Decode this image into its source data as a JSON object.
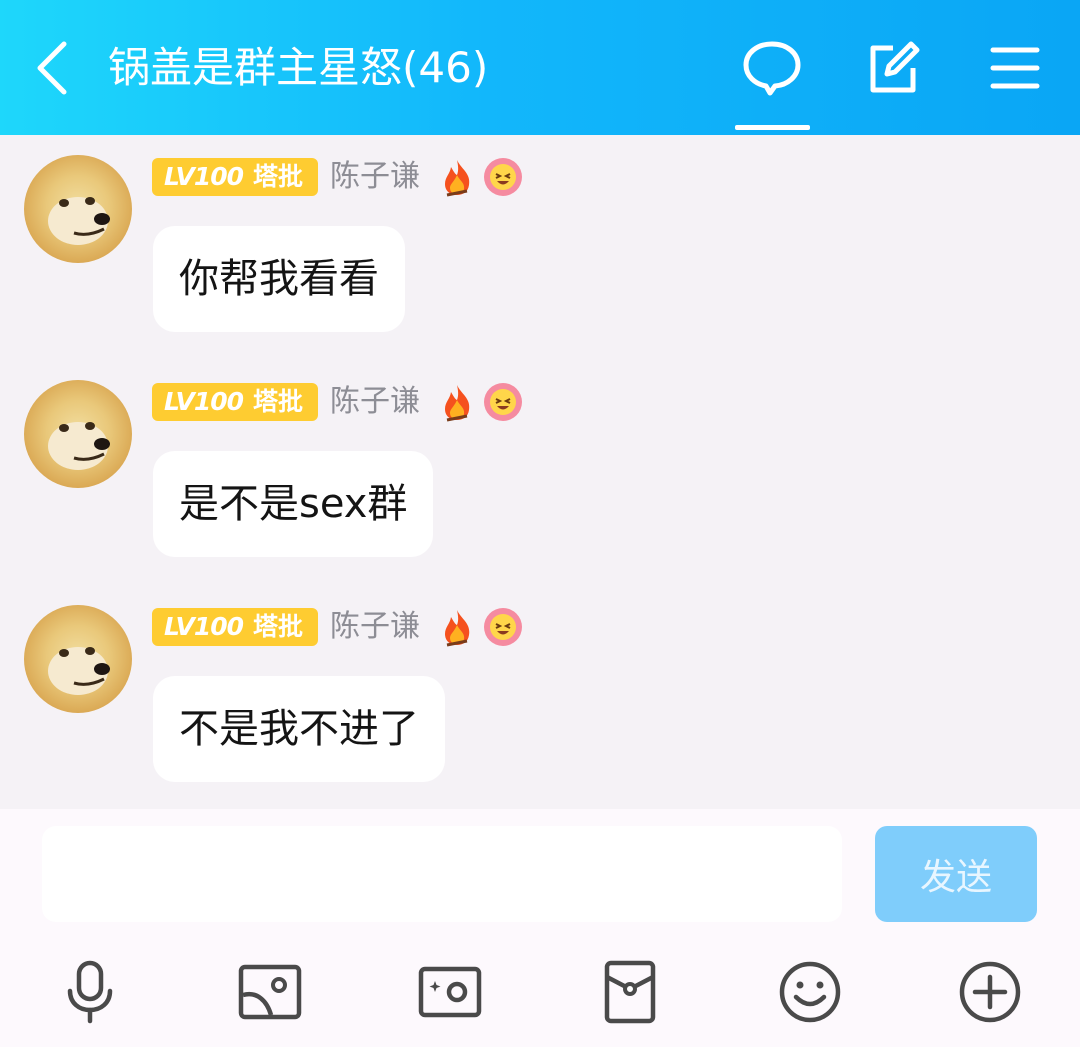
{
  "header": {
    "title": "锅盖是群主星怒(46)",
    "icons": [
      "back-arrow-icon",
      "chat-bubble-icon",
      "edit-icon",
      "menu-icon"
    ]
  },
  "messages": [
    {
      "level": "LV100",
      "title": "塔批",
      "sender": "陈子谦",
      "text": "你帮我看看"
    },
    {
      "level": "LV100",
      "title": "塔批",
      "sender": "陈子谦",
      "text": "是不是sex群"
    },
    {
      "level": "LV100",
      "title": "塔批",
      "sender": "陈子谦",
      "text": "不是我不进了"
    }
  ],
  "input": {
    "value": "",
    "send_label": "发送"
  },
  "toolbar": [
    "microphone-icon",
    "image-icon",
    "camera-icon",
    "red-packet-icon",
    "emoji-icon",
    "plus-icon"
  ],
  "colors": {
    "header_start": "#1ed7fb",
    "header_end": "#0aa6f5",
    "badge": "#fecc31",
    "send_button": "#7fcdfb",
    "background": "#f5f2f6"
  }
}
